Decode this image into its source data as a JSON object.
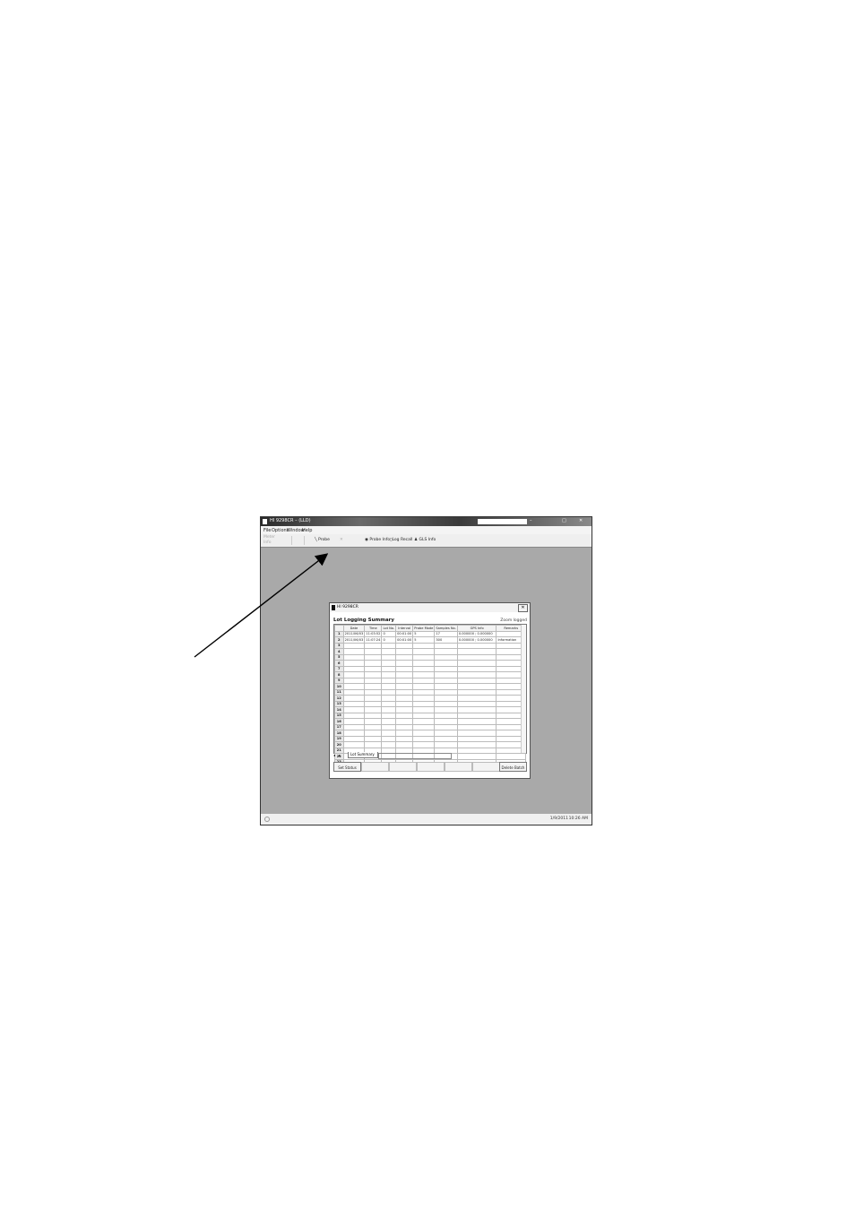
{
  "app": {
    "title": "HI 9298CR – (LLD)",
    "window_controls": [
      "–",
      "□",
      "✕"
    ],
    "menu": [
      "File",
      "Options",
      "Window",
      "Help"
    ],
    "toolbar": {
      "left_label_1": "Meter",
      "left_label_2": "Info",
      "probe": "Probe",
      "probe_info": "Probe Info",
      "log_recall": "Log Recall",
      "gls_info": "GLS Info"
    },
    "status": {
      "date": "1/9/2011",
      "time": "10:26 AM"
    }
  },
  "dialog": {
    "title": "HI 9298CR",
    "heading": "Lot Logging Summary",
    "zoom_label": "Zoom logged",
    "columns": [
      "",
      "Date",
      "Time",
      "Lot No.",
      "Interval",
      "Probe Mode",
      "Samples No.",
      "GPS Info",
      "Remarks"
    ],
    "rows": [
      [
        "1",
        "2011/06/03",
        "11:03:52",
        "0",
        "00:01:00",
        "5",
        "17",
        "0.000000 ; 0.000000",
        ""
      ],
      [
        "2",
        "2011/06/03",
        "11:07:24",
        "0",
        "00:01:00",
        "5",
        "300",
        "0.000000 ; 0.000000",
        "Information"
      ]
    ],
    "empty_row_numbers": [
      "3",
      "4",
      "5",
      "6",
      "7",
      "8",
      "9",
      "10",
      "11",
      "12",
      "13",
      "14",
      "15",
      "16",
      "17",
      "18",
      "19",
      "20",
      "21",
      "22",
      "23"
    ],
    "sheet_tab": "Lot Summary",
    "buttons": [
      "Set Status",
      "",
      "",
      "",
      "",
      "",
      "Delete Batch"
    ]
  }
}
